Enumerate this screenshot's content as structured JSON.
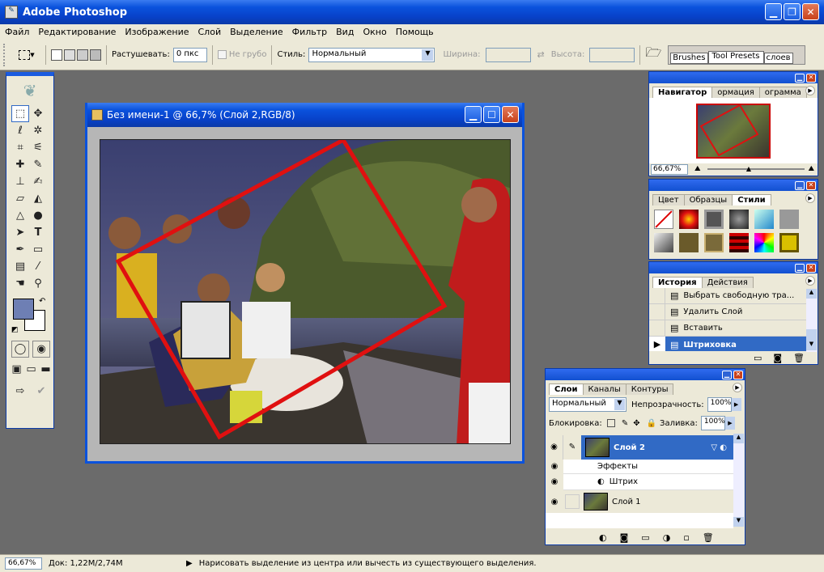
{
  "app": {
    "title": "Adobe Photoshop"
  },
  "menu": [
    "Файл",
    "Редактирование",
    "Изображение",
    "Слой",
    "Выделение",
    "Фильтр",
    "Вид",
    "Окно",
    "Помощь"
  ],
  "options": {
    "feather_label": "Растушевать:",
    "feather_value": "0 пкс",
    "antialias_label": "Не грубо",
    "style_label": "Стиль:",
    "style_value": "Нормальный",
    "width_label": "Ширина:",
    "height_label": "Высота:",
    "palette_well": [
      "Brushes",
      "Tool Presets",
      "слоев"
    ]
  },
  "document": {
    "title": "Без имени-1 @ 66,7% (Слой 2,RGB/8)"
  },
  "navigator": {
    "tabs": [
      "Навигатор",
      "ормация",
      "ограмма"
    ],
    "zoom": "66,67%"
  },
  "color_panel": {
    "tabs": [
      "Цвет",
      "Образцы",
      "Стили"
    ]
  },
  "history": {
    "tabs": [
      "История",
      "Действия"
    ],
    "items": [
      "Выбрать свободную тра...",
      "Удалить Слой",
      "Вставить",
      "Штриховка"
    ],
    "selected_index": 3
  },
  "layers": {
    "tabs": [
      "Слои",
      "Каналы",
      "Контуры"
    ],
    "blend_mode": "Нормальный",
    "opacity_label": "Непрозрачность:",
    "opacity_value": "100%",
    "lock_label": "Блокировка:",
    "fill_label": "Заливка:",
    "fill_value": "100%",
    "layer2": "Слой 2",
    "effects": "Эффекты",
    "stroke": "Штрих",
    "layer1": "Слой 1"
  },
  "status": {
    "zoom": "66,67%",
    "doc": "Док: 1,22M/2,74M",
    "hint": "Нарисовать выделение из центра или вычесть из существующего выделения."
  },
  "colors": {
    "foreground": "#6e7fb4",
    "background": "#ffffff",
    "accent": "#316ac5",
    "stroke": "#e01010"
  }
}
